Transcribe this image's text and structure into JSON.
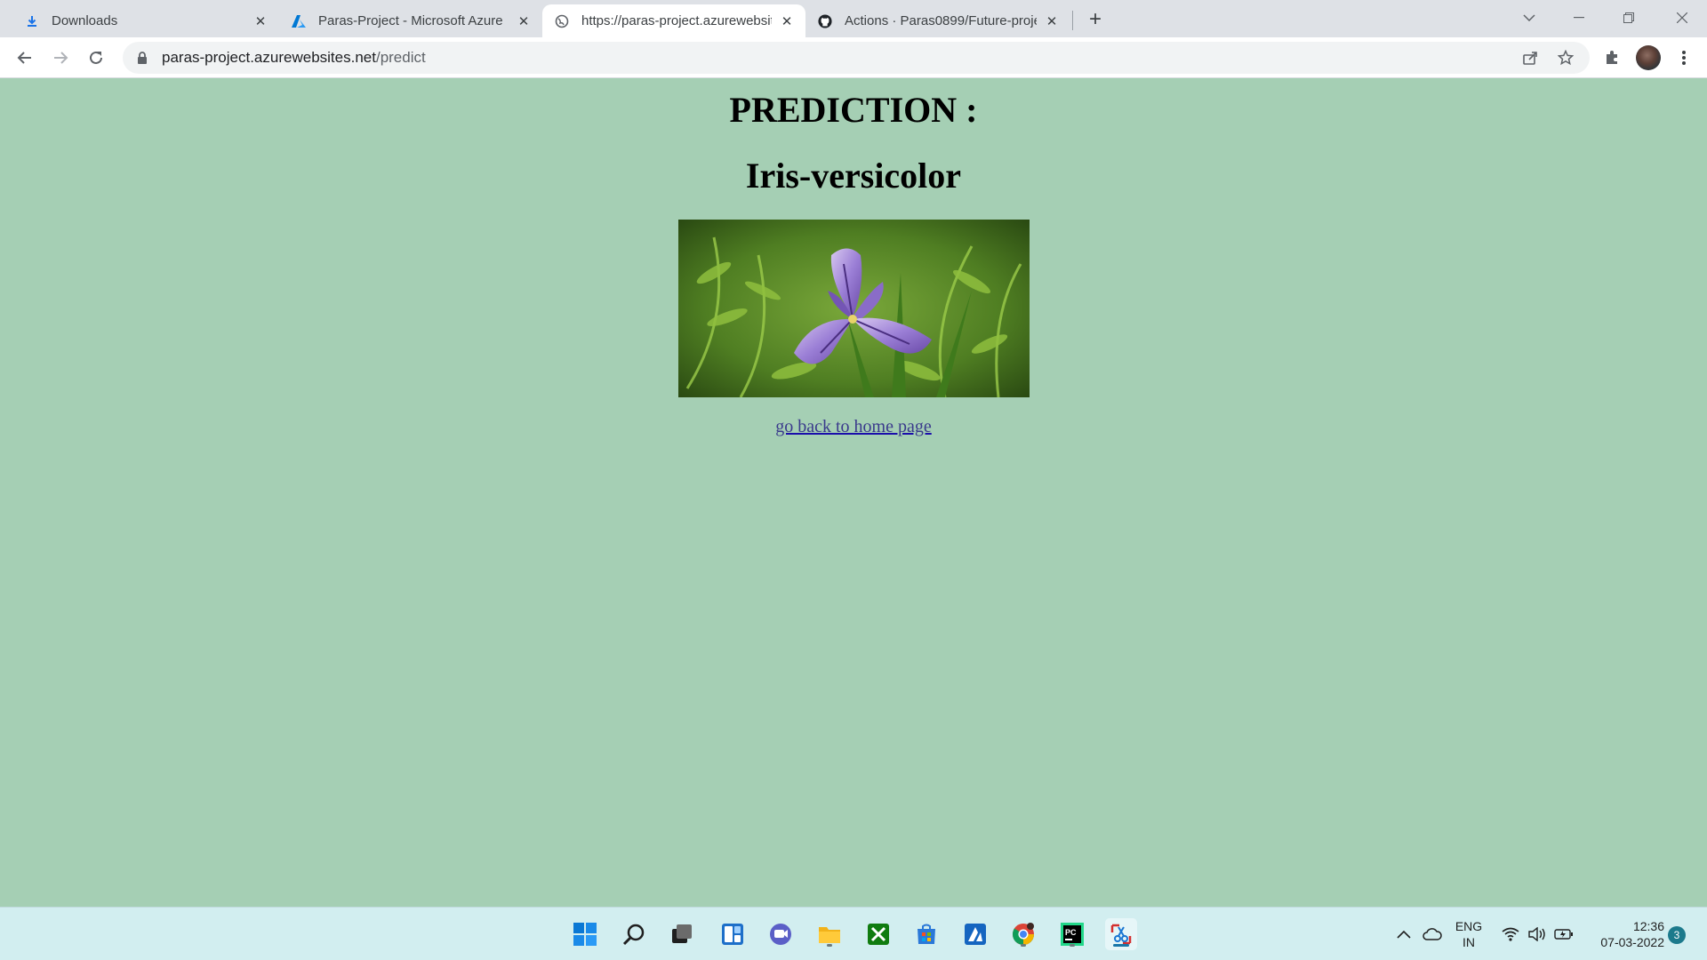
{
  "browser": {
    "tabs": [
      {
        "title": "Downloads",
        "icon": "download-icon",
        "active": false
      },
      {
        "title": "Paras-Project - Microsoft Azure",
        "icon": "azure-icon",
        "active": false
      },
      {
        "title": "https://paras-project.azurewebsit",
        "icon": "globe-icon",
        "active": true
      },
      {
        "title": "Actions · Paras0899/Future-proje",
        "icon": "github-icon",
        "active": false
      }
    ],
    "address": {
      "host": "paras-project.azurewebsites.net",
      "path": "/predict"
    }
  },
  "page": {
    "heading": "PREDICTION :",
    "prediction": "Iris-versicolor",
    "image_subject": "iris-versicolor-flower",
    "back_link": "go back to home page"
  },
  "taskbar": {
    "apps": [
      "start-icon",
      "search-icon",
      "task-view-icon",
      "widgets-icon",
      "chat-icon",
      "file-explorer-icon",
      "xbox-icon",
      "store-icon",
      "azure-data-studio-icon",
      "chrome-icon",
      "pycharm-icon",
      "snipping-tool-icon"
    ],
    "language": {
      "line1": "ENG",
      "line2": "IN"
    },
    "time": "12:36",
    "date": "07-03-2022",
    "notifications": "3"
  },
  "colors": {
    "page_background": "#a5cfb4",
    "link": "#3a3a8c",
    "taskbar": "#d2eef0"
  }
}
